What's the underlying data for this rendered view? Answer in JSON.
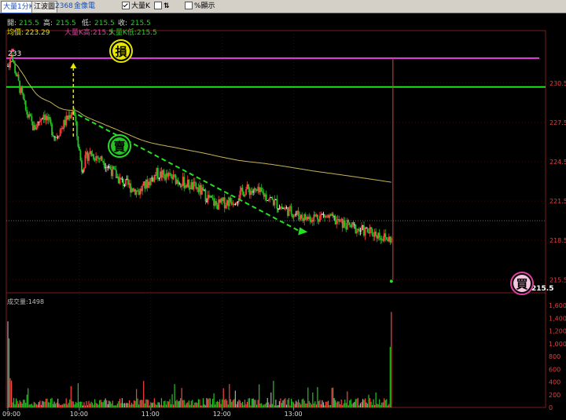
{
  "toolbar": {
    "tab_1min": "大量1分K",
    "tab_volprice": "江波圖",
    "stock_code": "2368",
    "stock_name": "金像電",
    "opt_bigvol": "大量K",
    "opt_arrows": "⇅",
    "opt_pct": "%顯示"
  },
  "info": {
    "open_label": "開:",
    "open_value": "215.5",
    "high_label": "高:",
    "high_value": "215.5",
    "low_label": "低:",
    "low_value": "215.5",
    "close_label": "收:",
    "close_value": "215.5",
    "avg_label": "均價:",
    "avg_value": "223.29",
    "bigk_high_label": "大量K高:",
    "bigk_high_value": "215.5",
    "bigk_low_label": "大量K低:",
    "bigk_low_value": "215.5"
  },
  "annotations": {
    "stop_label": "損",
    "sell_label": "賣",
    "buy_label": "買",
    "day_high_label": "233",
    "last_price_label": "215.5"
  },
  "volume_panel": {
    "title": "成交量:1498"
  },
  "colors": {
    "up": "#ff4040",
    "down": "#22c322",
    "flat": "#ffffff",
    "avg_line": "#c8b45a",
    "stop_line": "#e040e0",
    "support_line": "#22e022",
    "trend_line": "#22e022",
    "stop_marker": "#e6e600",
    "buy_marker": "#e040a0"
  },
  "chart_data": {
    "type": "candlestick",
    "y_axis": {
      "ticks": [
        "230.5",
        "227.5",
        "224.5",
        "221.5",
        "218.5",
        "215.5"
      ],
      "range": [
        214.5,
        234.5
      ]
    },
    "x_axis": {
      "ticks": [
        "09:00",
        "10:00",
        "11:00",
        "12:00",
        "13:00"
      ]
    },
    "volume_axis": {
      "ticks": [
        "1,600",
        "1,400",
        "1,200",
        "1,000",
        "800",
        "600",
        "400",
        "200",
        "0"
      ],
      "range": [
        0,
        1600
      ]
    },
    "levels": {
      "stop_loss": 232.4,
      "support": 230.2,
      "reference": 220.0
    },
    "trend_line": {
      "from": [
        "09:55",
        228.8
      ],
      "to": [
        "13:09",
        219.2
      ]
    },
    "markers": [
      {
        "label": "損",
        "time": "09:55",
        "price": 233.6
      },
      {
        "label": "賣",
        "time": "09:55",
        "price": 228.9
      },
      {
        "label": "買",
        "time": "13:10",
        "price": 218.0
      }
    ],
    "day_high": 233,
    "last": 215.5,
    "avg_price": 223.29
  }
}
